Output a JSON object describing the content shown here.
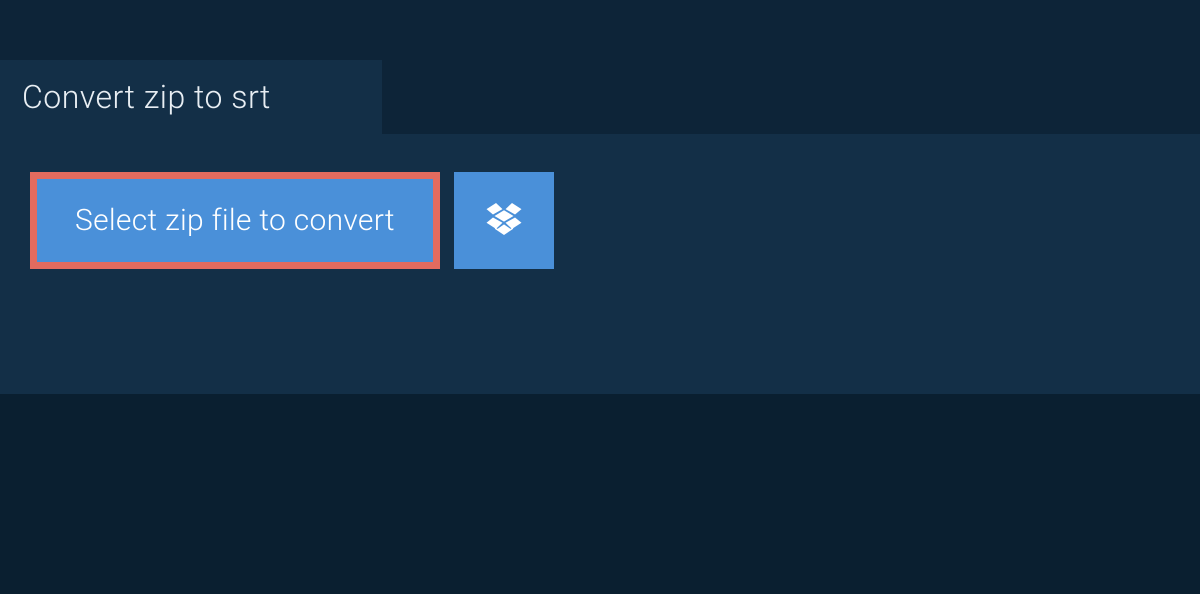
{
  "tab": {
    "title": "Convert zip to srt"
  },
  "actions": {
    "select_file_label": "Select zip file to convert"
  }
}
